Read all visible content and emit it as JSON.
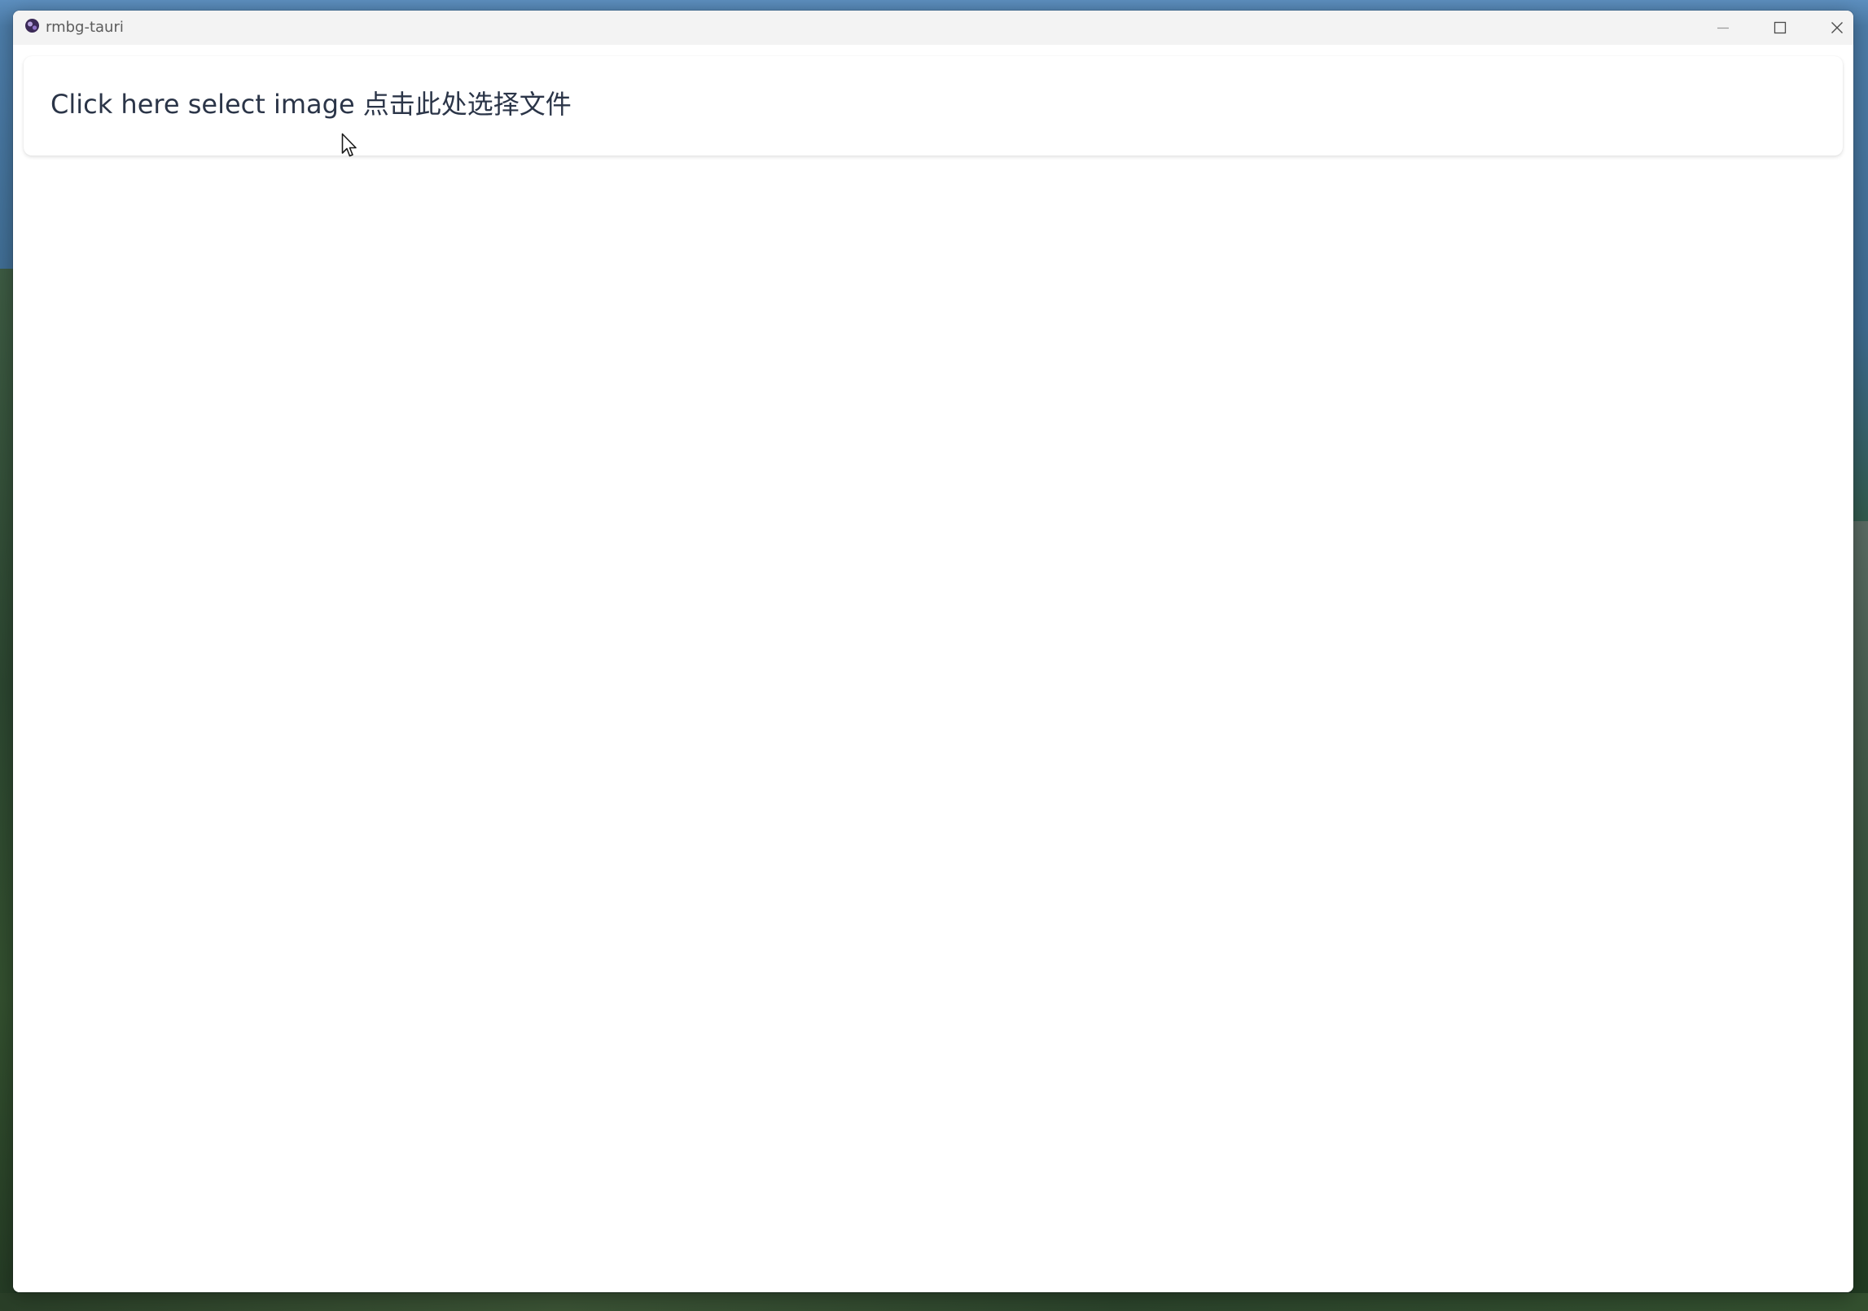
{
  "window": {
    "title": "rmbg-tauri",
    "app_icon": "tauri-app-icon",
    "controls": {
      "minimize_icon": "minimize-icon",
      "maximize_icon": "maximize-icon",
      "close_icon": "close-icon"
    }
  },
  "main": {
    "select_image_label": "Click here select image 点击此处选择文件"
  },
  "colors": {
    "titlebar_bg": "#f3f3f3",
    "label_text": "#2b3548",
    "title_text": "#5c5c5c"
  }
}
